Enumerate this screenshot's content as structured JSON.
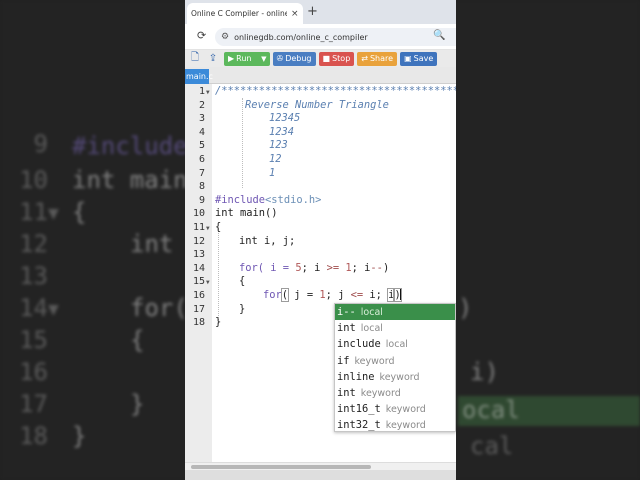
{
  "background": {
    "line_numbers": [
      "9",
      "10",
      "11",
      "12",
      "13",
      "14",
      "15",
      "16",
      "17",
      "18"
    ],
    "include_text": "#include",
    "main_text": "int main",
    "brace_open": "{",
    "int_text": "int",
    "for_text": "for(",
    "brace_inner": "{",
    "brace_inner_close": "}",
    "brace_close": "}",
    "right_paren": ")",
    "right_i": "i)",
    "right_local": "ocal",
    "right_local2": "cal"
  },
  "browser": {
    "tab_title": "Online C Compiler - online editor",
    "tab_close": "×",
    "new_tab": "+",
    "reload_icon": "⟳",
    "site_info_icon": "⚙",
    "url": "onlinegdb.com/online_c_compiler",
    "zoom_icon": "🔍",
    "extra_icon": "⋮"
  },
  "toolbar": {
    "new_file_icon": "🗋",
    "upload_icon": "⇪",
    "run_label": "Run",
    "run_icon": "▶",
    "run_caret": "▼",
    "debug_label": "Debug",
    "debug_icon": "✇",
    "stop_label": "Stop",
    "stop_icon": "■",
    "share_label": "Share",
    "share_icon": "⇄",
    "save_label": "Save",
    "save_icon": "▣"
  },
  "file_tab": "main.c",
  "editor": {
    "line_numbers": [
      "1",
      "2",
      "3",
      "4",
      "5",
      "6",
      "7",
      "8",
      "9",
      "10",
      "11",
      "12",
      "13",
      "14",
      "15",
      "16",
      "17",
      "18"
    ],
    "comment_open": "/*****************************************************",
    "comment_title": "Reverse Number Triangle",
    "rows": [
      "12345",
      "1234",
      "123",
      "12",
      "1"
    ],
    "include_kw": "#include",
    "include_hdr": "<stdio.h>",
    "main_sig": "int main()",
    "brace_open": "{",
    "decl": "int i, j;",
    "outer_for_a": "for( i = ",
    "outer_five": "5",
    "outer_for_b": "; i ",
    "outer_ge": ">=",
    "outer_one": " 1",
    "outer_for_c": "; i",
    "outer_dec": "--",
    "outer_for_d": ")",
    "inner_brace_open": "{",
    "inner_for_a": "for",
    "inner_paren": "(",
    "inner_for_b": " j = ",
    "inner_one": "1",
    "inner_for_c": "; j ",
    "inner_le": "<=",
    "inner_for_d": " i; ",
    "inner_i": "i",
    "inner_brace_close": "}",
    "brace_close": "}"
  },
  "autocomplete": [
    {
      "name": "i--",
      "meta": "local"
    },
    {
      "name": "int",
      "meta": "local"
    },
    {
      "name": "include",
      "meta": "local"
    },
    {
      "name": "if",
      "meta": "keyword"
    },
    {
      "name": "inline",
      "meta": "keyword"
    },
    {
      "name": "int",
      "meta": "keyword"
    },
    {
      "name": "int16_t",
      "meta": "keyword"
    },
    {
      "name": "int32_t",
      "meta": "keyword"
    }
  ],
  "colors": {
    "run": "#5cb85c",
    "debug": "#4a7ec2",
    "stop": "#d9534f",
    "share": "#e9a23b",
    "save": "#3f74bd",
    "file_tab": "#3b8ad9",
    "autocomplete_selected": "#3a8f4a"
  }
}
